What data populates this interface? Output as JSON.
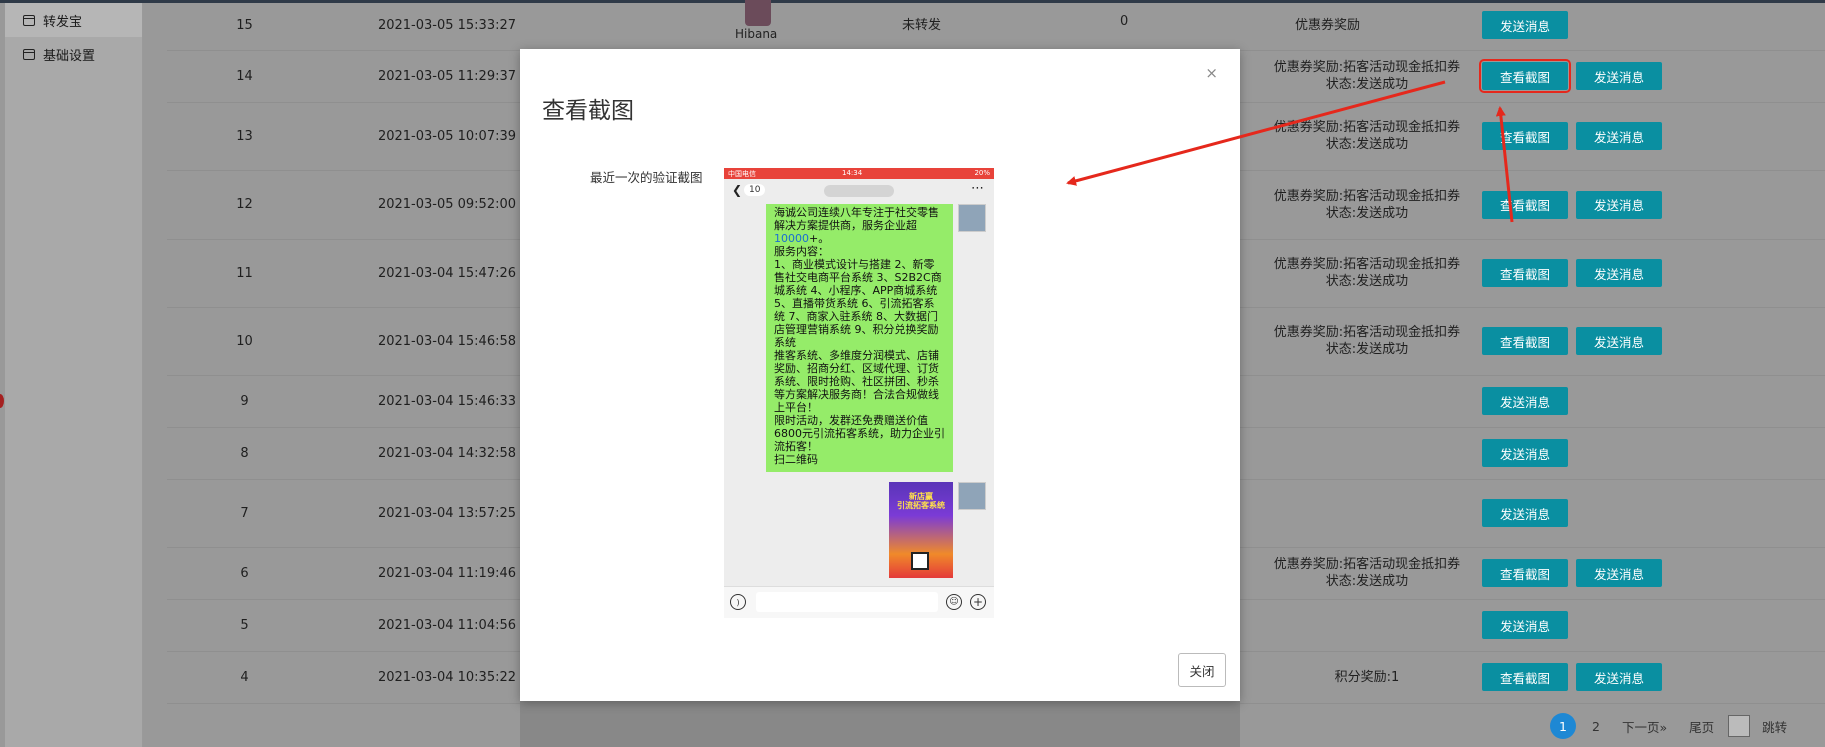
{
  "sidebar": {
    "items": [
      {
        "label": "转发宝",
        "active": true,
        "icon": "table-icon"
      },
      {
        "label": "基础设置",
        "active": false,
        "icon": "table-icon"
      }
    ]
  },
  "table": {
    "rows": [
      {
        "id": "15",
        "time": "2021-03-05 15:33:27",
        "status": "",
        "buttons": [
          "发送消息"
        ]
      },
      {
        "id": "14",
        "time": "2021-03-05 11:29:37",
        "status": "优惠券奖励:拓客活动现金抵扣券\n状态:发送成功",
        "buttons": [
          "查看截图",
          "发送消息"
        ]
      },
      {
        "id": "13",
        "time": "2021-03-05 10:07:39",
        "status": "优惠券奖励:拓客活动现金抵扣券\n状态:发送成功",
        "buttons": [
          "查看截图",
          "发送消息"
        ]
      },
      {
        "id": "12",
        "time": "2021-03-05 09:52:00",
        "status": "优惠券奖励:拓客活动现金抵扣券\n状态:发送成功",
        "buttons": [
          "查看截图",
          "发送消息"
        ]
      },
      {
        "id": "11",
        "time": "2021-03-04 15:47:26",
        "status": "优惠券奖励:拓客活动现金抵扣券\n状态:发送成功",
        "buttons": [
          "查看截图",
          "发送消息"
        ]
      },
      {
        "id": "10",
        "time": "2021-03-04 15:46:58",
        "status": "优惠券奖励:拓客活动现金抵扣券\n状态:发送成功",
        "buttons": [
          "查看截图",
          "发送消息"
        ]
      },
      {
        "id": "9",
        "time": "2021-03-04 15:46:33",
        "status": "",
        "buttons": [
          "发送消息"
        ]
      },
      {
        "id": "8",
        "time": "2021-03-04 14:32:58",
        "status": "",
        "buttons": [
          "发送消息"
        ]
      },
      {
        "id": "7",
        "time": "2021-03-04 13:57:25",
        "status": "",
        "buttons": [
          "发送消息"
        ]
      },
      {
        "id": "6",
        "time": "2021-03-04 11:19:46",
        "status": "优惠券奖励:拓客活动现金抵扣券\n状态:发送成功",
        "buttons": [
          "查看截图",
          "发送消息"
        ]
      },
      {
        "id": "5",
        "time": "2021-03-04 11:04:56",
        "status": "",
        "buttons": [
          "发送消息"
        ]
      },
      {
        "id": "4",
        "time": "2021-03-04 10:35:22",
        "status": "积分奖励:1",
        "buttons": [
          "查看截图",
          "发送消息"
        ]
      }
    ],
    "row15": {
      "nickname": "Hibana",
      "forward_status": "未转发",
      "count": "0",
      "reward": "优惠券奖励"
    }
  },
  "pager": {
    "current": "1",
    "page2": "2",
    "next": "下一页»",
    "last": "尾页",
    "jump": "跳转"
  },
  "modal": {
    "close_x": "×",
    "title": "查看截图",
    "field_label": "最近一次的验证截图",
    "close_button": "关闭",
    "phone": {
      "carrier": "中国电信",
      "time": "14:34",
      "battery": "20%",
      "back_badge": "10",
      "message": "海诚公司连续八年专注于社交零售解决方案提供商，服务企业超",
      "message_highlight": "10000",
      "message_rest": "+。\n服务内容：\n1、商业模式设计与搭建 2、新零售社交电商平台系统 3、S2B2C商城系统 4、小程序、APP商城系统 5、直播带货系统 6、引流拓客系统 7、商家入驻系统 8、大数据门店管理营销系统 9、积分兑换奖励系统\n推客系统、多维度分润模式、店铺奖励、招商分红、区域代理、订货系统、限时抢购、社区拼团、秒杀等方案解决服务商！合法合规做线上平台！\n限时活动，发群还免费赠送价值6800元引流拓客系统，助力企业引流拓客！\n扫二维码",
      "promo_text": "新店赢\n引流拓客系统"
    }
  }
}
